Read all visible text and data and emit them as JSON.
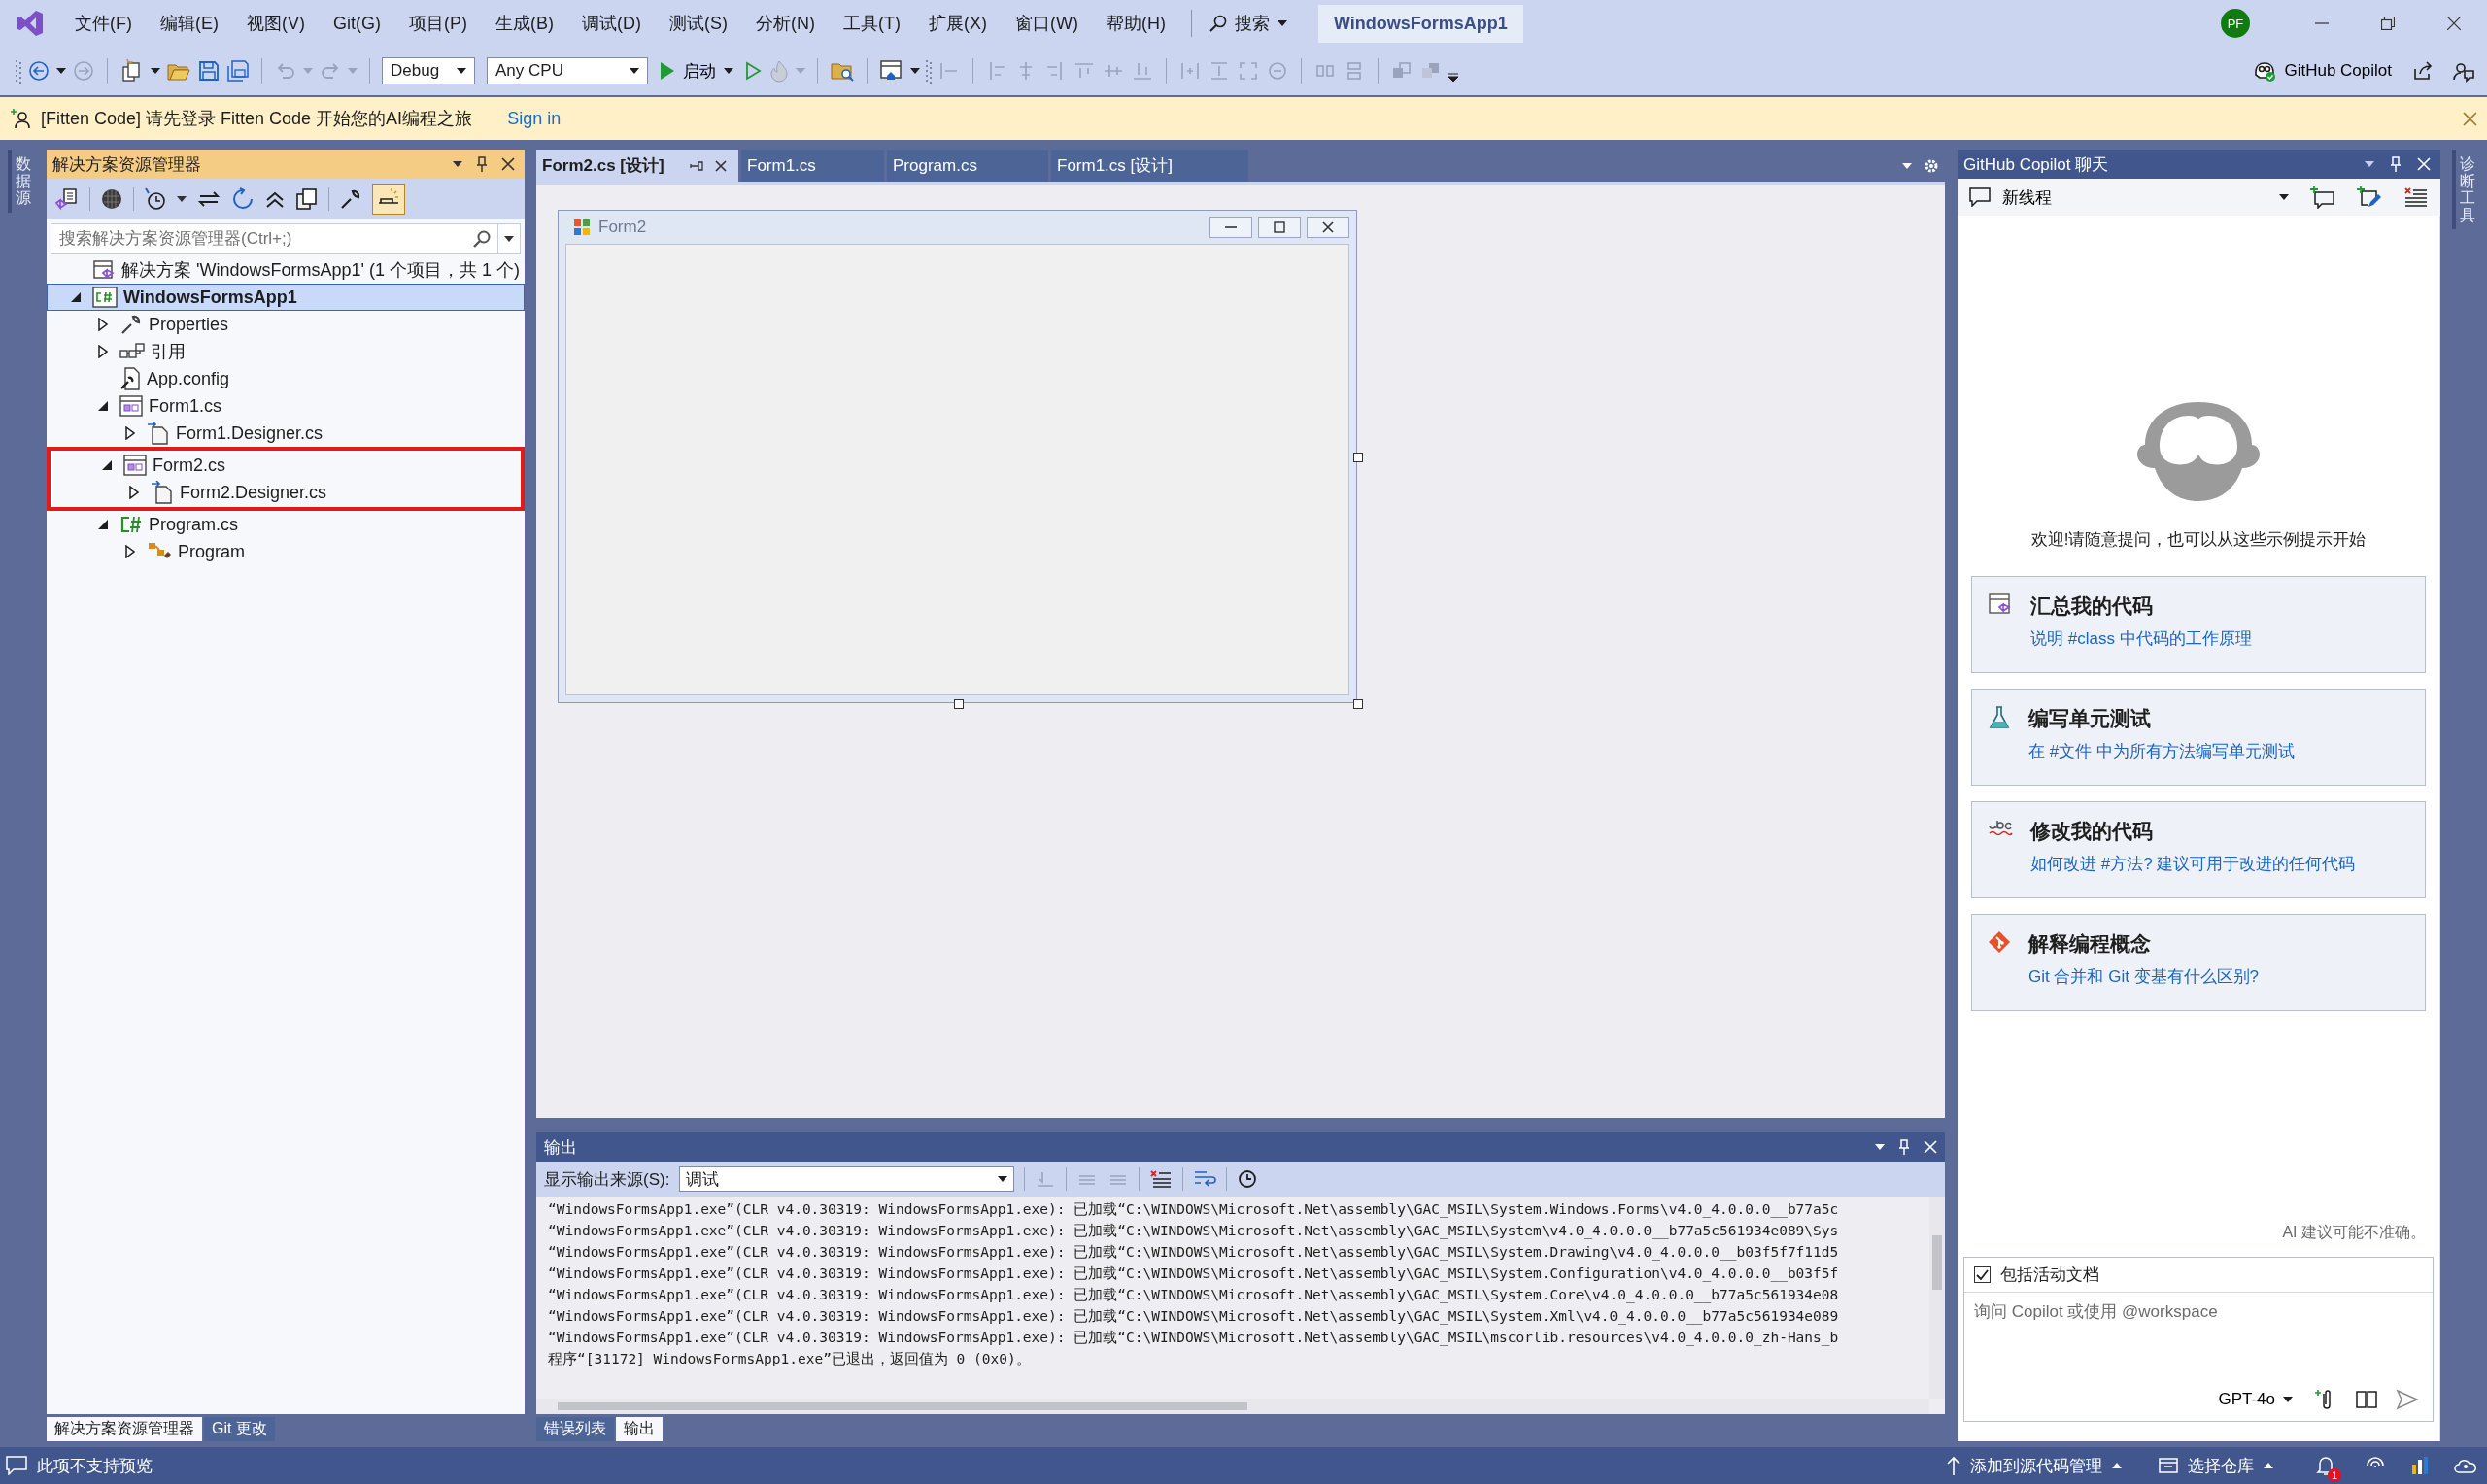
{
  "menu": [
    "文件(F)",
    "编辑(E)",
    "视图(V)",
    "Git(G)",
    "项目(P)",
    "生成(B)",
    "调试(D)",
    "测试(S)",
    "分析(N)",
    "工具(T)",
    "扩展(X)",
    "窗口(W)",
    "帮助(H)"
  ],
  "search": {
    "label": "搜索"
  },
  "solution_badge": "WindowsFormsApp1",
  "account": {
    "initials": "PF"
  },
  "toolbar": {
    "configuration": "Debug",
    "platform": "Any CPU",
    "start": "启动",
    "copilot": "GitHub Copilot"
  },
  "infobar": {
    "message": "[Fitten Code] 请先登录 Fitten Code 开始您的AI编程之旅",
    "link": "Sign in"
  },
  "left_dock": {
    "tabs": [
      "数据源"
    ]
  },
  "solution_explorer": {
    "title": "解决方案资源管理器",
    "search_placeholder": "搜索解决方案资源管理器(Ctrl+;)",
    "tree": [
      {
        "label": "解决方案 'WindowsFormsApp1' (1 个项目，共 1 个)",
        "kind": "solution",
        "selected": false,
        "children": [
          {
            "label": "WindowsFormsApp1",
            "kind": "project",
            "selected": true,
            "expanded": true,
            "children": [
              {
                "label": "Properties",
                "kind": "properties",
                "selected": false,
                "expanded": false
              },
              {
                "label": "引用",
                "kind": "references",
                "selected": false,
                "expanded": false
              },
              {
                "label": "App.config",
                "kind": "config",
                "selected": false
              },
              {
                "label": "Form1.cs",
                "kind": "form",
                "selected": false,
                "expanded": true,
                "children": [
                  {
                    "label": "Form1.Designer.cs",
                    "kind": "designer",
                    "selected": false,
                    "expanded": false
                  }
                ]
              },
              {
                "label": "Form2.cs",
                "kind": "form",
                "selected": false,
                "expanded": true,
                "highlighted": true,
                "children": [
                  {
                    "label": "Form2.Designer.cs",
                    "kind": "designer",
                    "selected": false,
                    "expanded": false
                  }
                ]
              },
              {
                "label": "Program.cs",
                "kind": "csharp",
                "selected": false,
                "expanded": true,
                "children": [
                  {
                    "label": "Program",
                    "kind": "class",
                    "selected": false,
                    "expanded": false
                  }
                ]
              }
            ]
          }
        ]
      }
    ],
    "tabs": [
      {
        "label": "解决方案资源管理器",
        "selected": true
      },
      {
        "label": "Git 更改",
        "selected": false
      }
    ]
  },
  "editor": {
    "tabs": [
      {
        "label": "Form2.cs [设计]",
        "selected": true
      },
      {
        "label": "Form1.cs",
        "selected": false
      },
      {
        "label": "Program.cs",
        "selected": false
      },
      {
        "label": "Form1.cs [设计]",
        "selected": false
      }
    ],
    "designer": {
      "form_title": "Form2"
    }
  },
  "output": {
    "title": "输出",
    "source_label": "显示输出来源(S):",
    "source": "调试",
    "lines": [
      "“WindowsFormsApp1.exe”(CLR v4.0.30319: WindowsFormsApp1.exe): 已加载“C:\\WINDOWS\\Microsoft.Net\\assembly\\GAC_MSIL\\System.Windows.Forms\\v4.0_4.0.0.0__b77a5c",
      "“WindowsFormsApp1.exe”(CLR v4.0.30319: WindowsFormsApp1.exe): 已加载“C:\\WINDOWS\\Microsoft.Net\\assembly\\GAC_MSIL\\System\\v4.0_4.0.0.0__b77a5c561934e089\\Sys",
      "“WindowsFormsApp1.exe”(CLR v4.0.30319: WindowsFormsApp1.exe): 已加载“C:\\WINDOWS\\Microsoft.Net\\assembly\\GAC_MSIL\\System.Drawing\\v4.0_4.0.0.0__b03f5f7f11d5",
      "“WindowsFormsApp1.exe”(CLR v4.0.30319: WindowsFormsApp1.exe): 已加载“C:\\WINDOWS\\Microsoft.Net\\assembly\\GAC_MSIL\\System.Configuration\\v4.0_4.0.0.0__b03f5f",
      "“WindowsFormsApp1.exe”(CLR v4.0.30319: WindowsFormsApp1.exe): 已加载“C:\\WINDOWS\\Microsoft.Net\\assembly\\GAC_MSIL\\System.Core\\v4.0_4.0.0.0__b77a5c561934e08",
      "“WindowsFormsApp1.exe”(CLR v4.0.30319: WindowsFormsApp1.exe): 已加载“C:\\WINDOWS\\Microsoft.Net\\assembly\\GAC_MSIL\\System.Xml\\v4.0_4.0.0.0__b77a5c561934e089",
      "“WindowsFormsApp1.exe”(CLR v4.0.30319: WindowsFormsApp1.exe): 已加载“C:\\WINDOWS\\Microsoft.Net\\assembly\\GAC_MSIL\\mscorlib.resources\\v4.0_4.0.0.0_zh-Hans_b",
      "程序“[31172] WindowsFormsApp1.exe”已退出，返回值为 0 (0x0)。"
    ],
    "tabs": [
      {
        "label": "错误列表",
        "selected": false
      },
      {
        "label": "输出",
        "selected": true
      }
    ]
  },
  "copilot_chat": {
    "title": "GitHub Copilot 聊天",
    "thread": "新线程",
    "welcome": "欢迎!请随意提问，也可以从这些示例提示开始",
    "suggestions": [
      {
        "kind": "summarize",
        "title": "汇总我的代码",
        "prompt": "说明 #class 中代码的工作原理"
      },
      {
        "kind": "test",
        "title": "编写单元测试",
        "prompt": "在 #文件 中为所有方法编写单元测试"
      },
      {
        "kind": "fix",
        "title": "修改我的代码",
        "prompt": "如何改进 #方法? 建议可用于改进的任何代码"
      },
      {
        "kind": "explain",
        "title": "解释编程概念",
        "prompt": "Git 合并和 Git 变基有什么区别?"
      }
    ],
    "disclaimer": "AI 建议可能不准确。",
    "include_document": {
      "label": "包括活动文档",
      "checked": true
    },
    "input_placeholder": "询问 Copilot 或使用 @workspace",
    "model": "GPT-4o"
  },
  "right_dock": {
    "tabs": [
      "诊断工具"
    ]
  },
  "status_bar": {
    "message": "此项不支持预览",
    "source_control": "添加到源代码管理",
    "repository": "选择仓库",
    "notifications": "1"
  }
}
